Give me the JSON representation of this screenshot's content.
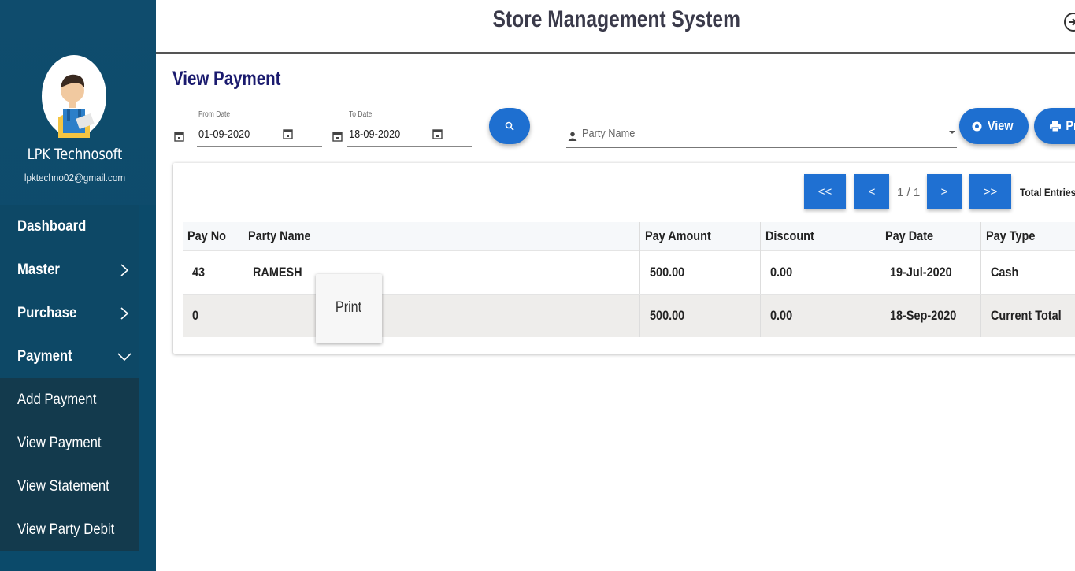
{
  "app": {
    "title": "Store Management System"
  },
  "user": {
    "name": "LPK Technosoft",
    "email": "lpktechno02@gmail.com"
  },
  "sidebar": {
    "items": [
      {
        "label": "Dashboard"
      },
      {
        "label": "Master"
      },
      {
        "label": "Purchase"
      },
      {
        "label": "Payment"
      }
    ],
    "payment_submenu": [
      {
        "label": "Add Payment"
      },
      {
        "label": "View Payment"
      },
      {
        "label": "View Statement"
      },
      {
        "label": "View Party Debit"
      }
    ]
  },
  "page": {
    "title": "View Payment"
  },
  "filters": {
    "from_date": {
      "label": "From Date",
      "value": "01-09-2020"
    },
    "to_date": {
      "label": "To Date",
      "value": "18-09-2020"
    },
    "party": {
      "placeholder": "Party Name"
    },
    "view_label": "View",
    "print_label": "Pr"
  },
  "pagination": {
    "first": "<<",
    "prev": "<",
    "page_text": "1 / 1",
    "next": ">",
    "last": ">>",
    "total_label": "Total Entries"
  },
  "table": {
    "headers": [
      "Pay No",
      "Party Name",
      "Pay Amount",
      "Discount",
      "Pay Date",
      "Pay Type"
    ],
    "rows": [
      [
        "43",
        "RAMESH",
        "500.00",
        "0.00",
        "19-Jul-2020",
        "Cash"
      ],
      [
        "0",
        "",
        "500.00",
        "0.00",
        "18-Sep-2020",
        "Current Total"
      ]
    ]
  },
  "tooltip": {
    "text": "Print"
  },
  "colors": {
    "sidebar": "#0d4866",
    "submenu": "#133a4d",
    "accent": "#1f70d2",
    "title": "#1a1a6e"
  }
}
